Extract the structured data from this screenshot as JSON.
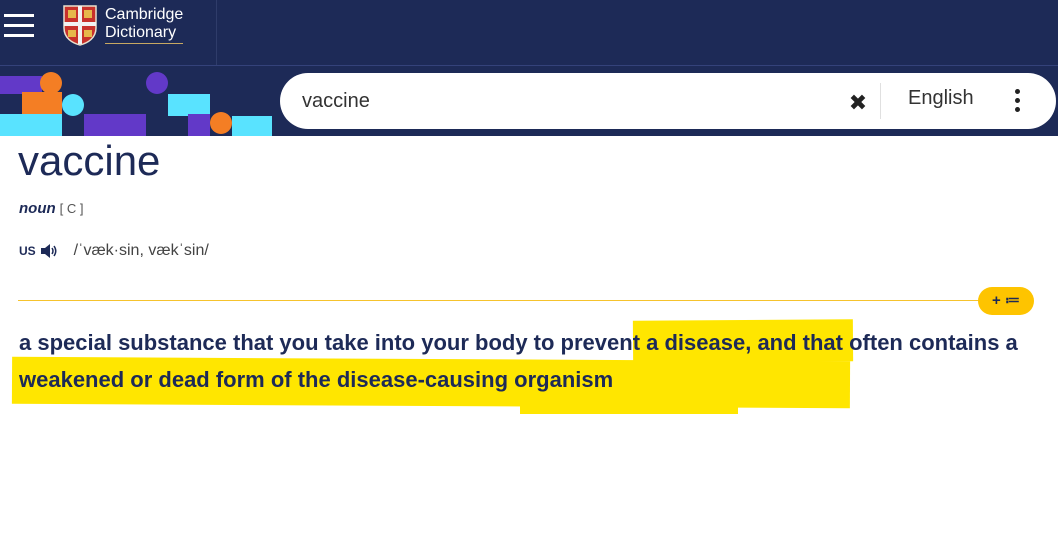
{
  "header": {
    "logo_line1": "Cambridge",
    "logo_line2": "Dictionary",
    "menu_icon": "hamburger-menu-icon",
    "crest_icon": "cambridge-crest-icon"
  },
  "search": {
    "value": "vaccine",
    "clear_icon": "close-icon",
    "language": "English",
    "more_icon": "more-vertical-icon"
  },
  "entry": {
    "headword": "vaccine",
    "pos": "noun",
    "grammar": "[ C ]",
    "region": "US",
    "audio_icon": "speaker-icon",
    "ipa": "/ˈvæk·sin, vækˈsin/",
    "add_to_list_label": "+ ≔",
    "definition": "a special substance that you take into your body to prevent a disease, and that often contains a weakened or dead form of the disease-causing organism"
  },
  "colors": {
    "navy": "#1d2a57",
    "highlight": "#ffe600",
    "accent_yellow": "#fec400",
    "orange": "#f47e24",
    "cyan": "#59e3ff",
    "purple": "#6239c8"
  }
}
